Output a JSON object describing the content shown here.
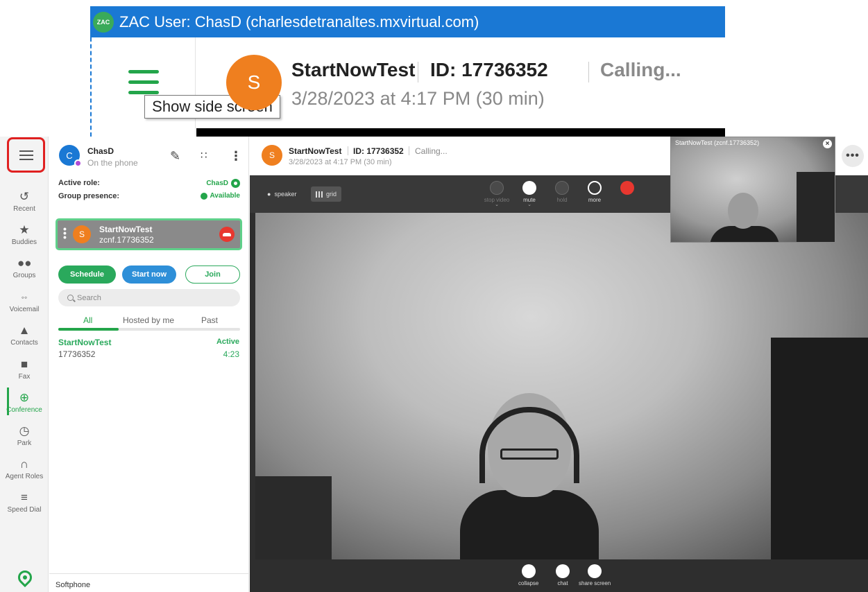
{
  "callout": {
    "window_title": "ZAC User: ChasD (charlesdetranaltes.mxvirtual.com)",
    "logo_text": "ZAC",
    "tooltip": "Show side screen",
    "avatar_letter": "S",
    "conf_name": "StartNowTest",
    "conf_id": "ID: 17736352",
    "status": "Calling...",
    "datetime": "3/28/2023 at 4:17 PM (30 min)"
  },
  "rail": {
    "items": [
      {
        "label": "Recent",
        "icon": "clock-history-icon"
      },
      {
        "label": "Buddies",
        "icon": "star-icon"
      },
      {
        "label": "Groups",
        "icon": "groups-icon"
      },
      {
        "label": "Voicemail",
        "icon": "voicemail-icon"
      },
      {
        "label": "Contacts",
        "icon": "contact-icon"
      },
      {
        "label": "Fax",
        "icon": "fax-icon"
      },
      {
        "label": "Conference",
        "icon": "globe-icon"
      },
      {
        "label": "Park",
        "icon": "park-icon"
      },
      {
        "label": "Agent Roles",
        "icon": "headset-icon"
      },
      {
        "label": "Speed Dial",
        "icon": "speed-dial-icon"
      }
    ],
    "active": "Conference"
  },
  "user": {
    "avatar_letter": "C",
    "name": "ChasD",
    "status": "On the phone"
  },
  "roles": {
    "active_role_label": "Active role:",
    "active_role_value": "ChasD",
    "group_presence_label": "Group presence:",
    "group_presence_value": "Available"
  },
  "active_call": {
    "avatar_letter": "S",
    "name": "StartNowTest",
    "sub": "zcnf.17736352"
  },
  "buttons": {
    "schedule": "Schedule",
    "start_now": "Start now",
    "join": "Join"
  },
  "search": {
    "placeholder": "Search"
  },
  "tabs": [
    "All",
    "Hosted by me",
    "Past"
  ],
  "conferences": [
    {
      "name": "StartNowTest",
      "id": "17736352",
      "state": "Active",
      "duration": "4:23"
    }
  ],
  "footer": {
    "softphone": "Softphone"
  },
  "call": {
    "avatar_letter": "S",
    "name": "StartNowTest",
    "id": "ID: 17736352",
    "status": "Calling...",
    "datetime": "3/28/2023 at 4:17 PM (30 min)",
    "more": "•••"
  },
  "controls": {
    "speaker": "speaker",
    "grid": "grid",
    "stop_video": "stop video",
    "mute": "mute",
    "hold": "hold",
    "more": "more"
  },
  "pip": {
    "label": "StartNowTest (zcnf.17736352)",
    "close": "×"
  },
  "bottom": {
    "collapse": "collapse",
    "chat": "chat",
    "share_screen": "share screen"
  },
  "colors": {
    "accent_green": "#23a54a",
    "titlebar_blue": "#1a78d4",
    "hangup_red": "#e8372f",
    "avatar_orange": "#ef7f1f",
    "highlight_red": "#e02020"
  }
}
